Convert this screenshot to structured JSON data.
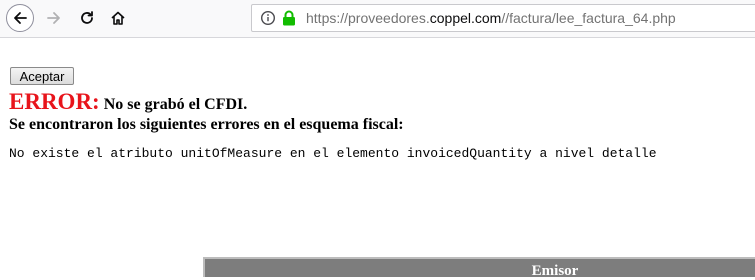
{
  "browser": {
    "url_prefix": "https://proveedores.",
    "url_domain": "coppel.com",
    "url_path": "//factura/lee_factura_64.php",
    "icons": [
      "back-arrow-icon",
      "forward-arrow-icon",
      "reload-icon",
      "home-icon",
      "info-icon",
      "lock-icon"
    ],
    "lock_color": "#12bc00"
  },
  "page": {
    "accept_button": "Aceptar",
    "error_word": "ERROR:",
    "error_message": "No se grabó el CFDI.",
    "errors_heading": "Se encontraron los siguientes errores en el esquema fiscal:",
    "error_detail": "No existe el atributo unitOfMeasure en el elemento invoicedQuantity a nivel detalle",
    "table_header": "Emisor",
    "error_color": "#e8141b"
  }
}
